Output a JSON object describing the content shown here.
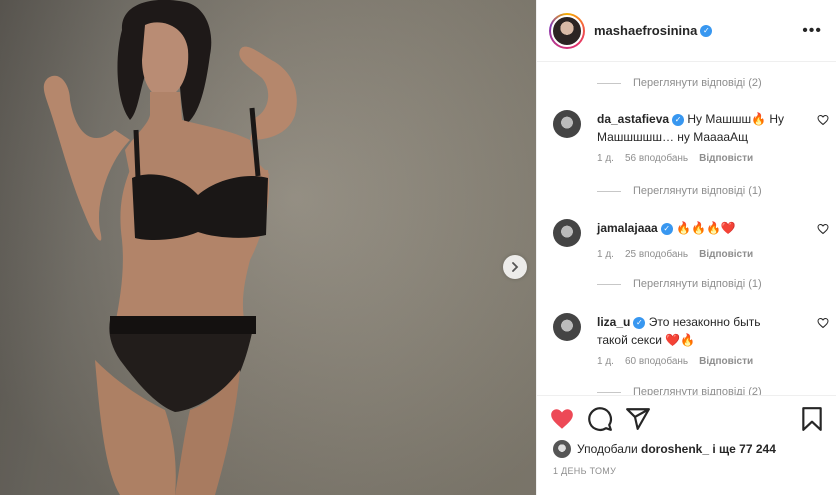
{
  "post": {
    "username": "mashaefrosinina",
    "more_icon": "more-icon",
    "photo_alt": "photo"
  },
  "comments": [
    {
      "username": "da_astafieva",
      "text": "Ну Машшш🔥 Ну Машшшшш… ну МааааАщ",
      "age": "1 д.",
      "likes": "56 вподобань",
      "reply": "Відповісти",
      "view_replies": "Переглянути відповіді (1)"
    },
    {
      "username": "jamalajaaa",
      "text": "🔥🔥🔥❤️",
      "age": "1 д.",
      "likes": "25 вподобань",
      "reply": "Відповісти",
      "view_replies": "Переглянути відповіді (1)"
    },
    {
      "username": "liza_u",
      "text": "Это незаконно быть такой секси ❤️🔥",
      "age": "1 д.",
      "likes": "60 вподобань",
      "reply": "Відповісти",
      "view_replies": "Переглянути відповіді (2)"
    }
  ],
  "top_view_replies": "Переглянути відповіді (2)",
  "likes": {
    "prefix": "Уподобали",
    "user": "doroshenk_",
    "suffix": "і ще 77 244"
  },
  "timestamp": "1 ДЕНЬ ТОМУ",
  "colors": {
    "like_red": "#ed4956",
    "verified_blue": "#3897f0",
    "muted_text": "#8e8e8e"
  }
}
